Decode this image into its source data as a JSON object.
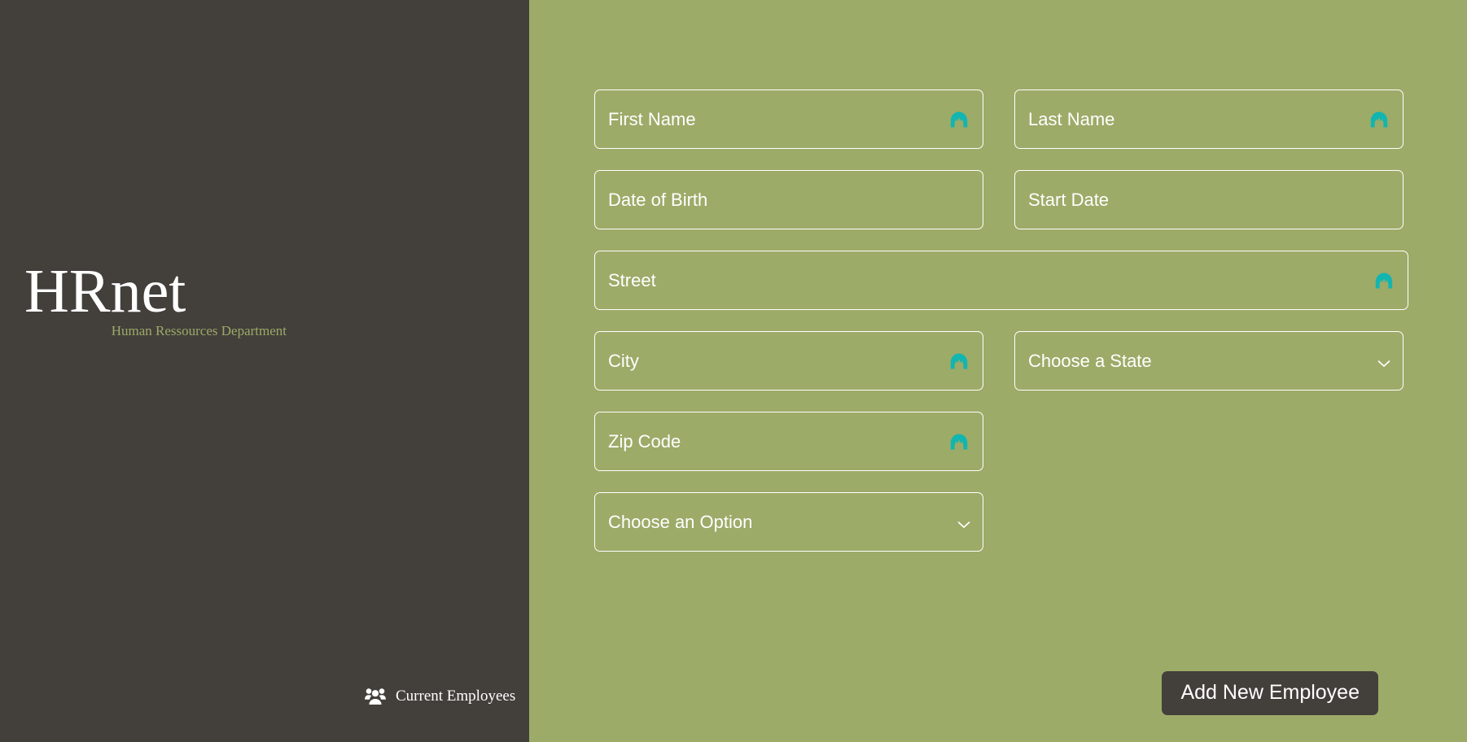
{
  "sidebar": {
    "brand_title": "HRnet",
    "brand_subtitle": "Human Ressources Department",
    "link": {
      "label": "Current Employees",
      "icon": "people-group-icon"
    }
  },
  "colors": {
    "sidebar_background": "#433f3b",
    "content_background": "#9cab68",
    "field_border": "#ffffff",
    "text": "#ffffff",
    "subtitle": "#9cab68",
    "autofill_icon": "#12b5b0",
    "button_background": "#433f3b"
  },
  "form": {
    "fields": [
      {
        "name": "first-name",
        "type": "text",
        "placeholder": "First Name",
        "value": "",
        "autofill_icon": true,
        "width": "half"
      },
      {
        "name": "last-name",
        "type": "text",
        "placeholder": "Last Name",
        "value": "",
        "autofill_icon": true,
        "width": "half"
      },
      {
        "name": "date-of-birth",
        "type": "text",
        "placeholder": "Date of Birth",
        "value": "",
        "autofill_icon": false,
        "width": "half"
      },
      {
        "name": "start-date",
        "type": "text",
        "placeholder": "Start Date",
        "value": "",
        "autofill_icon": false,
        "width": "half"
      },
      {
        "name": "street",
        "type": "text",
        "placeholder": "Street",
        "value": "",
        "autofill_icon": true,
        "width": "full"
      },
      {
        "name": "city",
        "type": "text",
        "placeholder": "City",
        "value": "",
        "autofill_icon": true,
        "width": "half"
      },
      {
        "name": "state",
        "type": "select",
        "placeholder": "Choose a State",
        "value": "Choose a State",
        "autofill_icon": false,
        "width": "half"
      },
      {
        "name": "zip-code",
        "type": "text",
        "placeholder": "Zip Code",
        "value": "",
        "autofill_icon": true,
        "width": "half"
      },
      {
        "name": "department",
        "type": "select",
        "placeholder": "Choose an Option",
        "value": "Choose an Option",
        "autofill_icon": false,
        "width": "half"
      }
    ],
    "submit_label": "Add New Employee"
  }
}
